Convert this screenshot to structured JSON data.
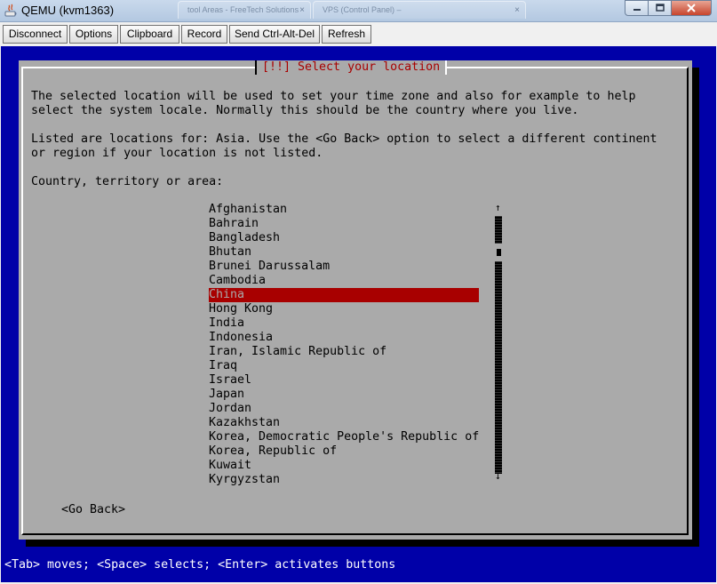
{
  "window": {
    "title": "QEMU (kvm1363)",
    "ghost_tabs": [
      {
        "label": "tool Areas - FreeTech Solutions"
      },
      {
        "label": "VPS (Control Panel) –"
      }
    ],
    "ghost_close": "×"
  },
  "toolbar": {
    "disconnect": "Disconnect",
    "options": "Options",
    "clipboard": "Clipboard",
    "record": "Record",
    "send_cad": "Send Ctrl-Alt-Del",
    "refresh": "Refresh"
  },
  "dialog": {
    "title": "[!!] Select your location",
    "para1_line1": "The selected location will be used to set your time zone and also for example to help",
    "para1_line2": "select the system locale. Normally this should be the country where you live.",
    "para2_line1": "Listed are locations for: Asia. Use the <Go Back> option to select a different continent",
    "para2_line2": "or region if your location is not listed.",
    "prompt": "Country, territory or area:",
    "countries": [
      "Afghanistan",
      "Bahrain",
      "Bangladesh",
      "Bhutan",
      "Brunei Darussalam",
      "Cambodia",
      "China",
      "Hong Kong",
      "India",
      "Indonesia",
      "Iran, Islamic Republic of",
      "Iraq",
      "Israel",
      "Japan",
      "Jordan",
      "Kazakhstan",
      "Korea, Democratic People's Republic of",
      "Korea, Republic of",
      "Kuwait",
      "Kyrgyzstan"
    ],
    "selected_country": "China",
    "scroll_up": "↑",
    "scroll_down": "↓",
    "go_back": "<Go Back>"
  },
  "status": "<Tab> moves; <Space> selects; <Enter> activates buttons",
  "colors": {
    "console_bg": "#0000a8",
    "dialog_bg": "#aaaaaa",
    "title_fg": "#a80000",
    "selection_bg": "#a80000"
  }
}
